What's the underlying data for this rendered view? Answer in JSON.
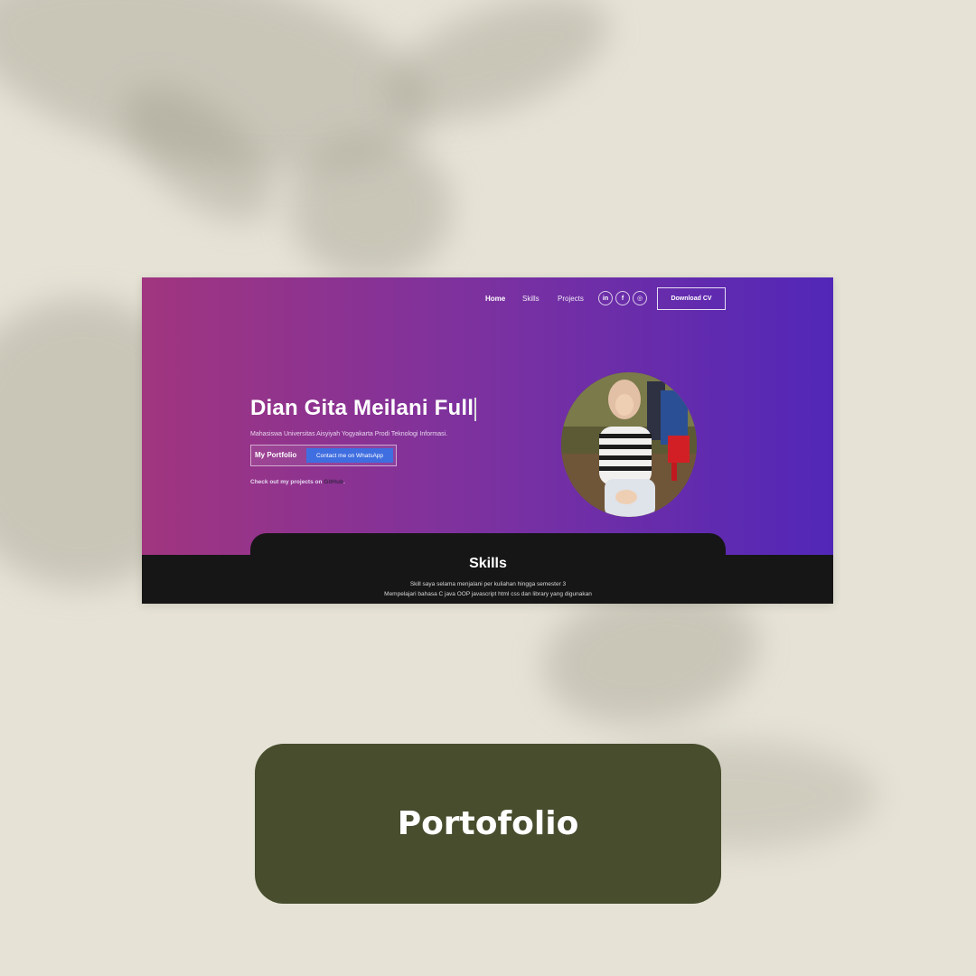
{
  "nav": {
    "home": "Home",
    "skills": "Skills",
    "projects": "Projects",
    "social": [
      {
        "label": "in",
        "icon": "linkedin-icon"
      },
      {
        "label": "f",
        "icon": "facebook-icon"
      },
      {
        "label": "◎",
        "icon": "instagram-icon"
      }
    ],
    "download_cv": "Download CV"
  },
  "hero": {
    "title": "Dian Gita Meilani Full",
    "subtitle": "Mahasiswa Universitas Aisyiyah Yogyakarta Prodi Teknologi Informasi.",
    "portfolio_label": "My Portfolio",
    "whatsapp_label": "Contact me on WhatsApp",
    "github_prefix": "Check out my projects on ",
    "github_link": "GitHub",
    "github_suffix": "."
  },
  "skills": {
    "title": "Skills",
    "line1": "Skill saya selama menjalani per kuliahan hingga semester 3",
    "line2": "Mempelajari bahasa C java OOP javascript html css dan library yang digunakan"
  },
  "cta": {
    "label": "Portofolio"
  },
  "colors": {
    "background": "#e6e3d6",
    "gradient_start": "#a1357f",
    "gradient_end": "#5227b8",
    "dark": "#161616",
    "button_blue": "#3f6ee0",
    "cta_bg": "#474d2d"
  }
}
